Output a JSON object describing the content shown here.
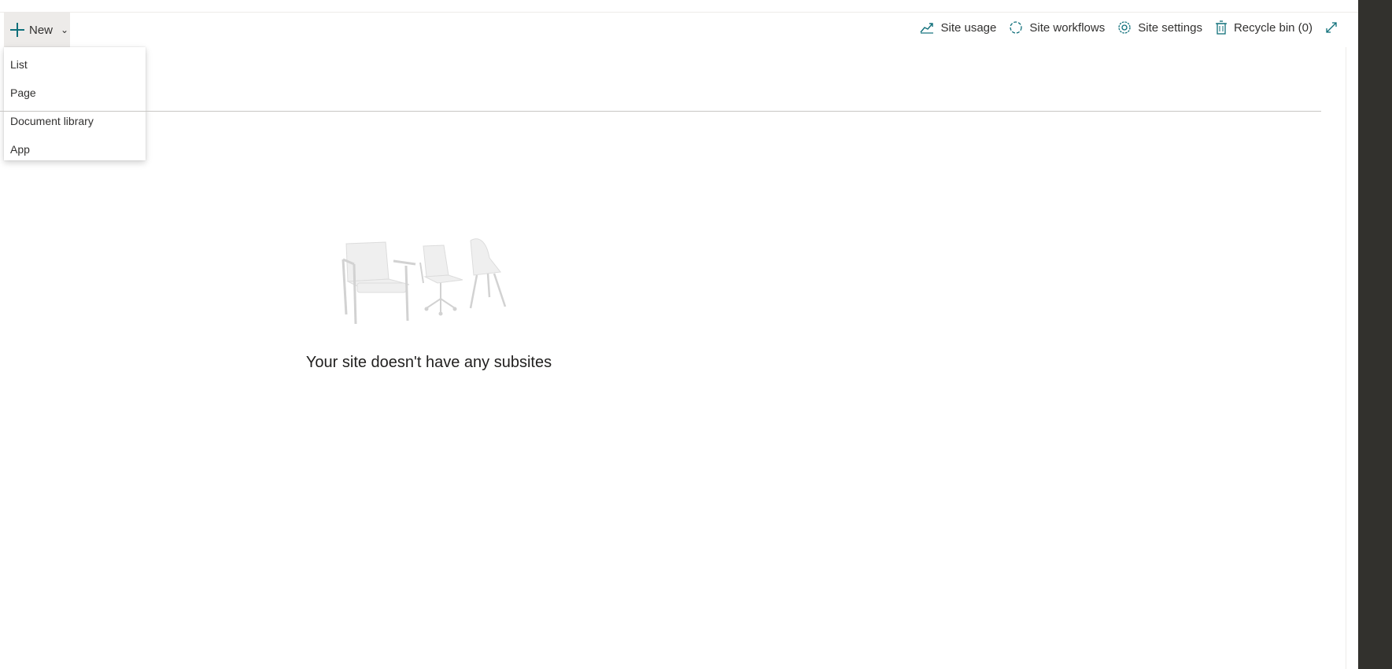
{
  "commandbar": {
    "new_label": "New",
    "actions": [
      {
        "label": "Site usage",
        "icon": "site-usage-icon"
      },
      {
        "label": "Site workflows",
        "icon": "site-workflows-icon"
      },
      {
        "label": "Site settings",
        "icon": "gear-icon"
      },
      {
        "label": "Recycle bin (0)",
        "icon": "recycle-bin-icon"
      }
    ],
    "expand_icon": "expand-icon"
  },
  "new_menu": {
    "items": [
      "List",
      "Page",
      "Document library",
      "App"
    ]
  },
  "empty_state": {
    "message": "Your site doesn't have any subsites",
    "illustration": "chairs-illustration"
  },
  "colors": {
    "accent": "#0f6f7a",
    "frame": "#32312d",
    "hover_bg": "#edebe9"
  }
}
